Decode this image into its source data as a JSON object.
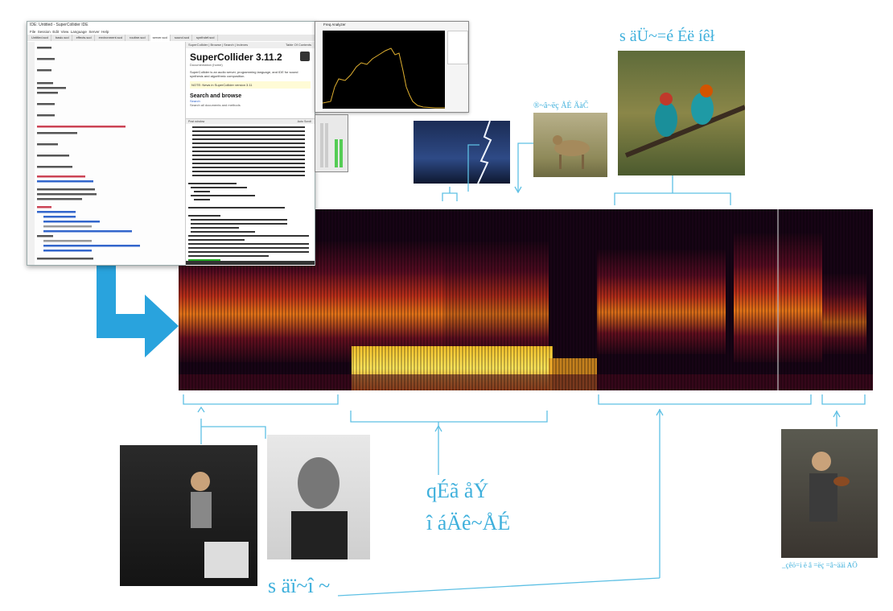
{
  "ide": {
    "title": "IDE: Untitled - SuperCollider IDE",
    "menu": [
      "File",
      "Session",
      "Edit",
      "View",
      "Language",
      "Server",
      "Help"
    ],
    "tabs": [
      "Untitled.scd",
      "basic.scd",
      "effects.scd",
      "environment.scd",
      "routine.scd",
      "server.scd",
      "sound.scd",
      "synthdef.scd"
    ],
    "active_tab": "server.scd",
    "help": {
      "tabs": [
        "SuperCollider",
        "Browse",
        "Search",
        "Indexes"
      ],
      "toc": "Table Of Contents",
      "title": "SuperCollider 3.11.2",
      "subtitle": "Documentation (home)",
      "description": "SuperCollider is an audio server, programming language, and IDE for sound synthesis and algorithmic composition.",
      "note": "NOTE: News in SuperCollider version 3.11",
      "section": "Search and browse",
      "link": "Search",
      "link2": "Search all documents and methods"
    },
    "post": {
      "header": "Post window",
      "auto_scroll": "Auto Scroll"
    }
  },
  "freq": {
    "title": "Freq Analyzer"
  },
  "labels": {
    "top_right": "s äÜ~=é Éë íêł",
    "small_animal": "®~â~ëç ÅÉ ÄàČ",
    "middle": "qÉã åÝ",
    "middle_line2": "î áÄê~ÅÉ",
    "bottom_left": "s äï~î ~",
    "bottom_right": "_çêö=i ë â =ëç =â~ääì AÖ"
  },
  "colors": {
    "accent": "#3fb0dc",
    "arrow": "#29a3dd"
  }
}
